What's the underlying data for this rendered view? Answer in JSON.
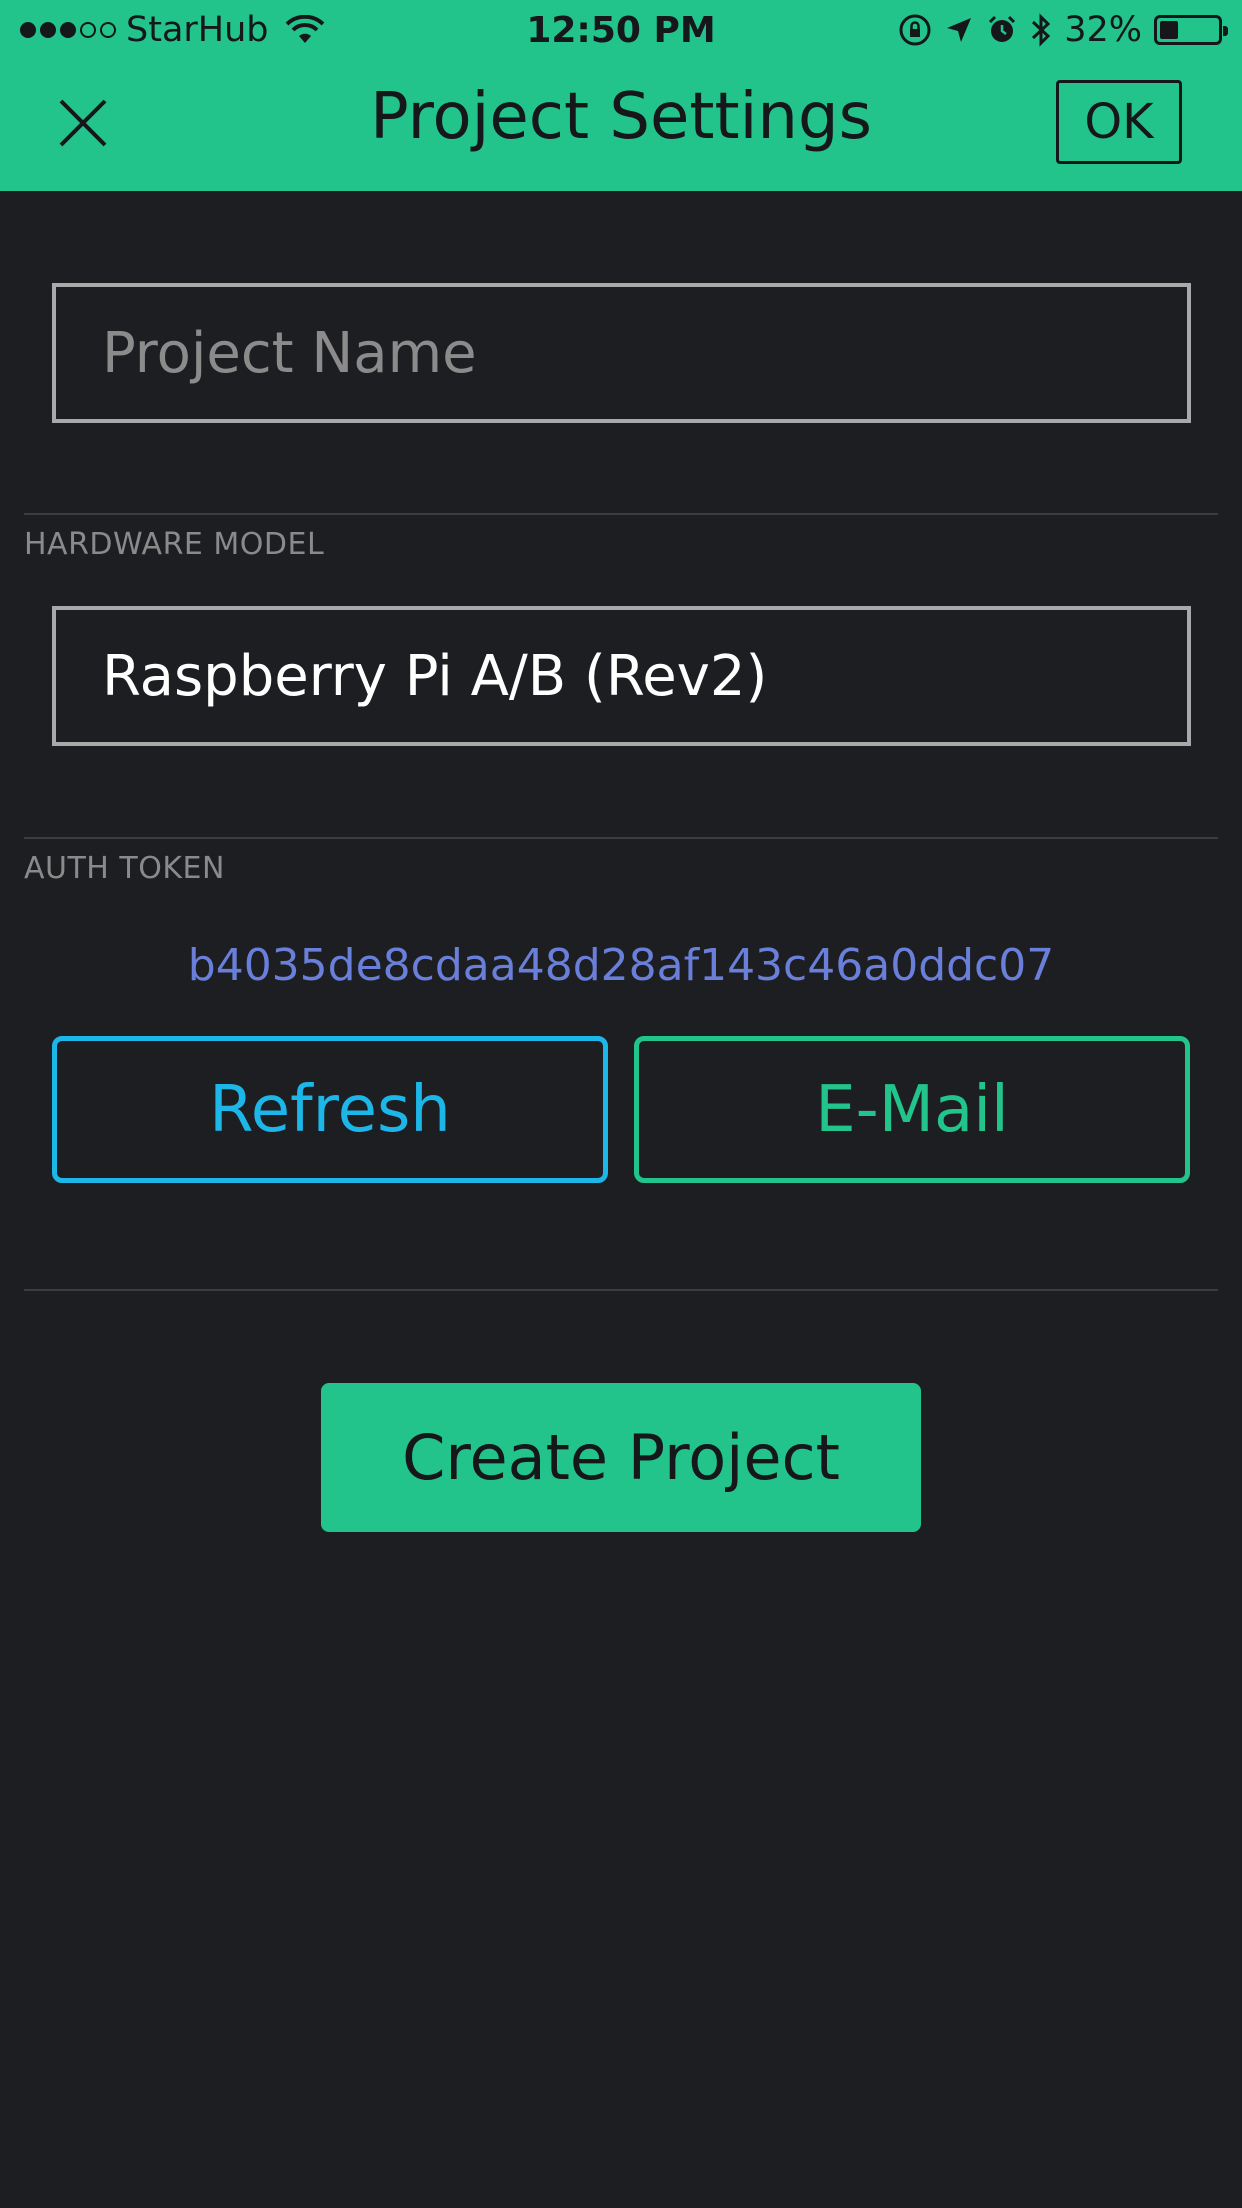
{
  "status_bar": {
    "carrier": "StarHub",
    "time": "12:50 PM",
    "battery_percent": "32%",
    "battery_level": 0.32,
    "signal_bars_filled": 3,
    "signal_bars_total": 5
  },
  "nav": {
    "title": "Project Settings",
    "ok_label": "OK",
    "close_icon": "close-icon"
  },
  "form": {
    "project_name": {
      "placeholder": "Project Name",
      "value": ""
    },
    "hardware": {
      "label": "HARDWARE MODEL",
      "value": "Raspberry Pi A/B (Rev2)"
    },
    "auth": {
      "label": "AUTH TOKEN",
      "token": "b4035de8cdaa48d28af143c46a0ddc07",
      "refresh_label": "Refresh",
      "email_label": "E-Mail"
    },
    "create_label": "Create Project"
  },
  "colors": {
    "accent": "#22c48b",
    "background": "#1d1e22",
    "refresh": "#1cb6e8",
    "token": "#6a7fd9"
  }
}
